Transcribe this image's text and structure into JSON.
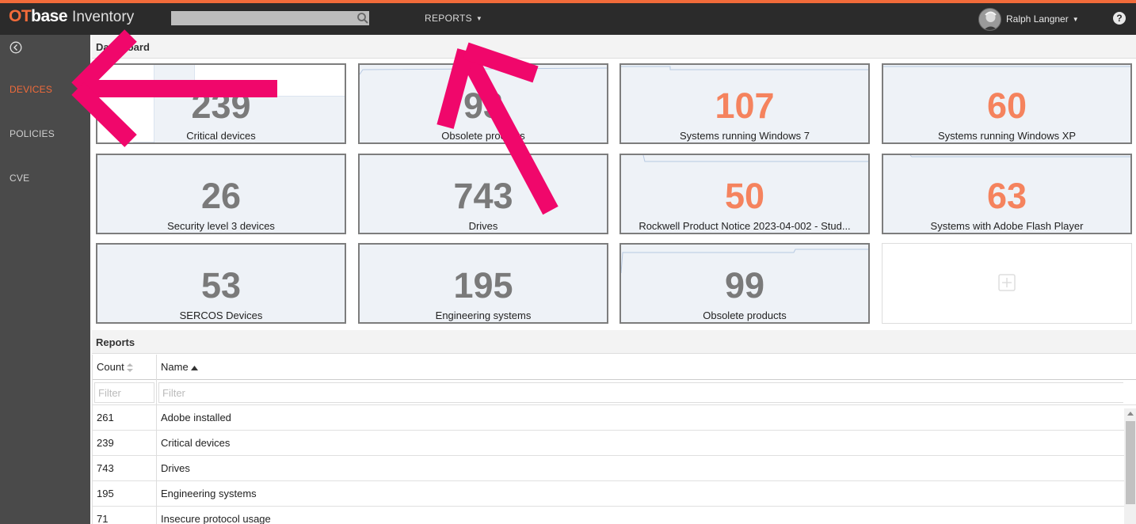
{
  "app": {
    "logo_ot": "OT",
    "logo_base": "base",
    "logo_module": "Inventory",
    "accent_color": "#f26b3a"
  },
  "topbar": {
    "search": {
      "value": "",
      "placeholder": ""
    },
    "reports_menu": "REPORTS",
    "user_name": "Ralph Langner",
    "help": "?"
  },
  "sidebar": {
    "items": [
      {
        "label": "DEVICES",
        "active": true
      },
      {
        "label": "POLICIES",
        "active": false
      },
      {
        "label": "CVE",
        "active": false
      }
    ]
  },
  "dashboard": {
    "title": "Dashboard",
    "tiles": [
      {
        "value": "239",
        "label": "Critical devices",
        "highlight": false
      },
      {
        "value": "93",
        "label": "Obsolete products",
        "highlight": false
      },
      {
        "value": "107",
        "label": "Systems running Windows 7",
        "highlight": true
      },
      {
        "value": "60",
        "label": "Systems running Windows XP",
        "highlight": true
      },
      {
        "value": "26",
        "label": "Security level 3 devices",
        "highlight": false
      },
      {
        "value": "743",
        "label": "Drives",
        "highlight": false
      },
      {
        "value": "50",
        "label": "Rockwell Product Notice 2023-04-002 - Stud...",
        "highlight": true
      },
      {
        "value": "63",
        "label": "Systems with Adobe Flash Player",
        "highlight": true
      },
      {
        "value": "53",
        "label": "SERCOS Devices",
        "highlight": false
      },
      {
        "value": "195",
        "label": "Engineering systems",
        "highlight": false
      },
      {
        "value": "99",
        "label": "Obsolete products",
        "highlight": false
      }
    ]
  },
  "reports": {
    "title": "Reports",
    "columns": {
      "count": "Count",
      "name": "Name"
    },
    "filter_placeholder": "Filter",
    "rows": [
      {
        "count": "261",
        "name": "Adobe installed"
      },
      {
        "count": "239",
        "name": "Critical devices"
      },
      {
        "count": "743",
        "name": "Drives"
      },
      {
        "count": "195",
        "name": "Engineering systems"
      },
      {
        "count": "71",
        "name": "Insecure protocol usage"
      }
    ]
  },
  "annotation_color": "#f0076b"
}
